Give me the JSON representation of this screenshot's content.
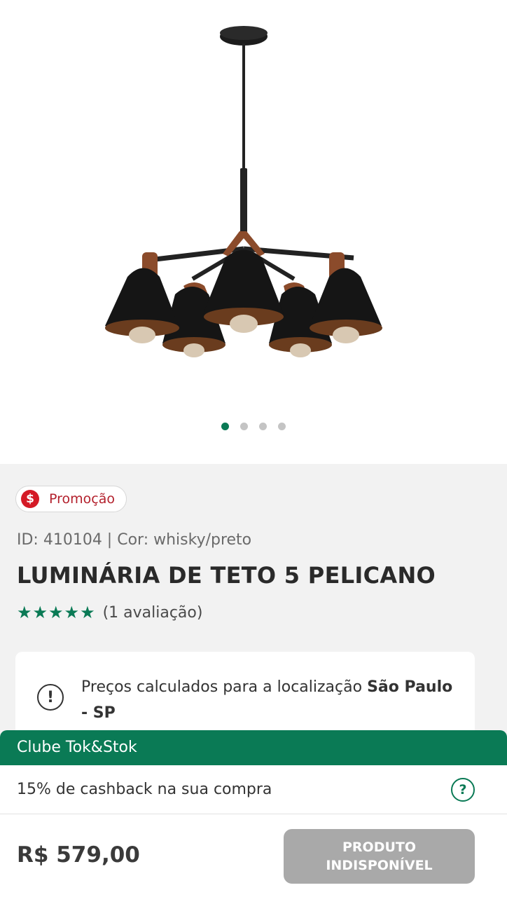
{
  "gallery": {
    "dot_count": 4,
    "active_index": 0
  },
  "product": {
    "promo_icon": "$",
    "promo_label": "Promoção",
    "meta": "ID: 410104 | Cor: whisky/preto",
    "title": "LUMINÁRIA DE TETO 5 PELICANO",
    "rating": {
      "stars": "★★★★★",
      "value": 5,
      "count_label": "(1 avaliação)"
    }
  },
  "location": {
    "icon": "!",
    "text": "Preços calculados para a localização",
    "city": "São Paulo - SP"
  },
  "club": {
    "title": "Clube Tok&Stok",
    "cashback": "15% de cashback na sua compra",
    "help_icon": "?"
  },
  "purchase": {
    "price": "R$ 579,00",
    "button_label": "PRODUTO\nINDISPONÍVEL"
  },
  "colors": {
    "brand_green": "#0a7a55",
    "promo_red": "#d41a26",
    "disabled_gray": "#a9a9a9"
  }
}
